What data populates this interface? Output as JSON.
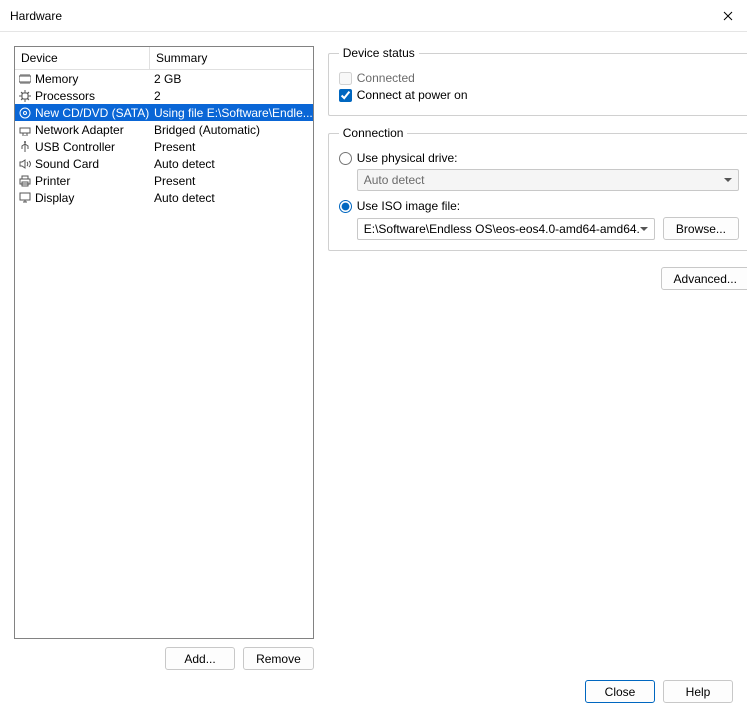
{
  "window": {
    "title": "Hardware"
  },
  "table": {
    "col_device": "Device",
    "col_summary": "Summary",
    "rows": [
      {
        "name": "Memory",
        "summary": "2 GB",
        "icon": "memory"
      },
      {
        "name": "Processors",
        "summary": "2",
        "icon": "processors"
      },
      {
        "name": "New CD/DVD (SATA)",
        "summary": "Using file E:\\Software\\Endle...",
        "icon": "cd",
        "selected": true
      },
      {
        "name": "Network Adapter",
        "summary": "Bridged (Automatic)",
        "icon": "network"
      },
      {
        "name": "USB Controller",
        "summary": "Present",
        "icon": "usb"
      },
      {
        "name": "Sound Card",
        "summary": "Auto detect",
        "icon": "sound"
      },
      {
        "name": "Printer",
        "summary": "Present",
        "icon": "printer"
      },
      {
        "name": "Display",
        "summary": "Auto detect",
        "icon": "display"
      }
    ],
    "add_label": "Add...",
    "remove_label": "Remove"
  },
  "status": {
    "legend": "Device status",
    "connected_label": "Connected",
    "connected_checked": false,
    "power_on_label": "Connect at power on",
    "power_on_checked": true
  },
  "connection": {
    "legend": "Connection",
    "physical_label": "Use physical drive:",
    "physical_selected": false,
    "physical_value": "Auto detect",
    "iso_label": "Use ISO image file:",
    "iso_selected": true,
    "iso_value": "E:\\Software\\Endless OS\\eos-eos4.0-amd64-amd64.",
    "browse_label": "Browse...",
    "advanced_label": "Advanced..."
  },
  "footer": {
    "close_label": "Close",
    "help_label": "Help"
  }
}
